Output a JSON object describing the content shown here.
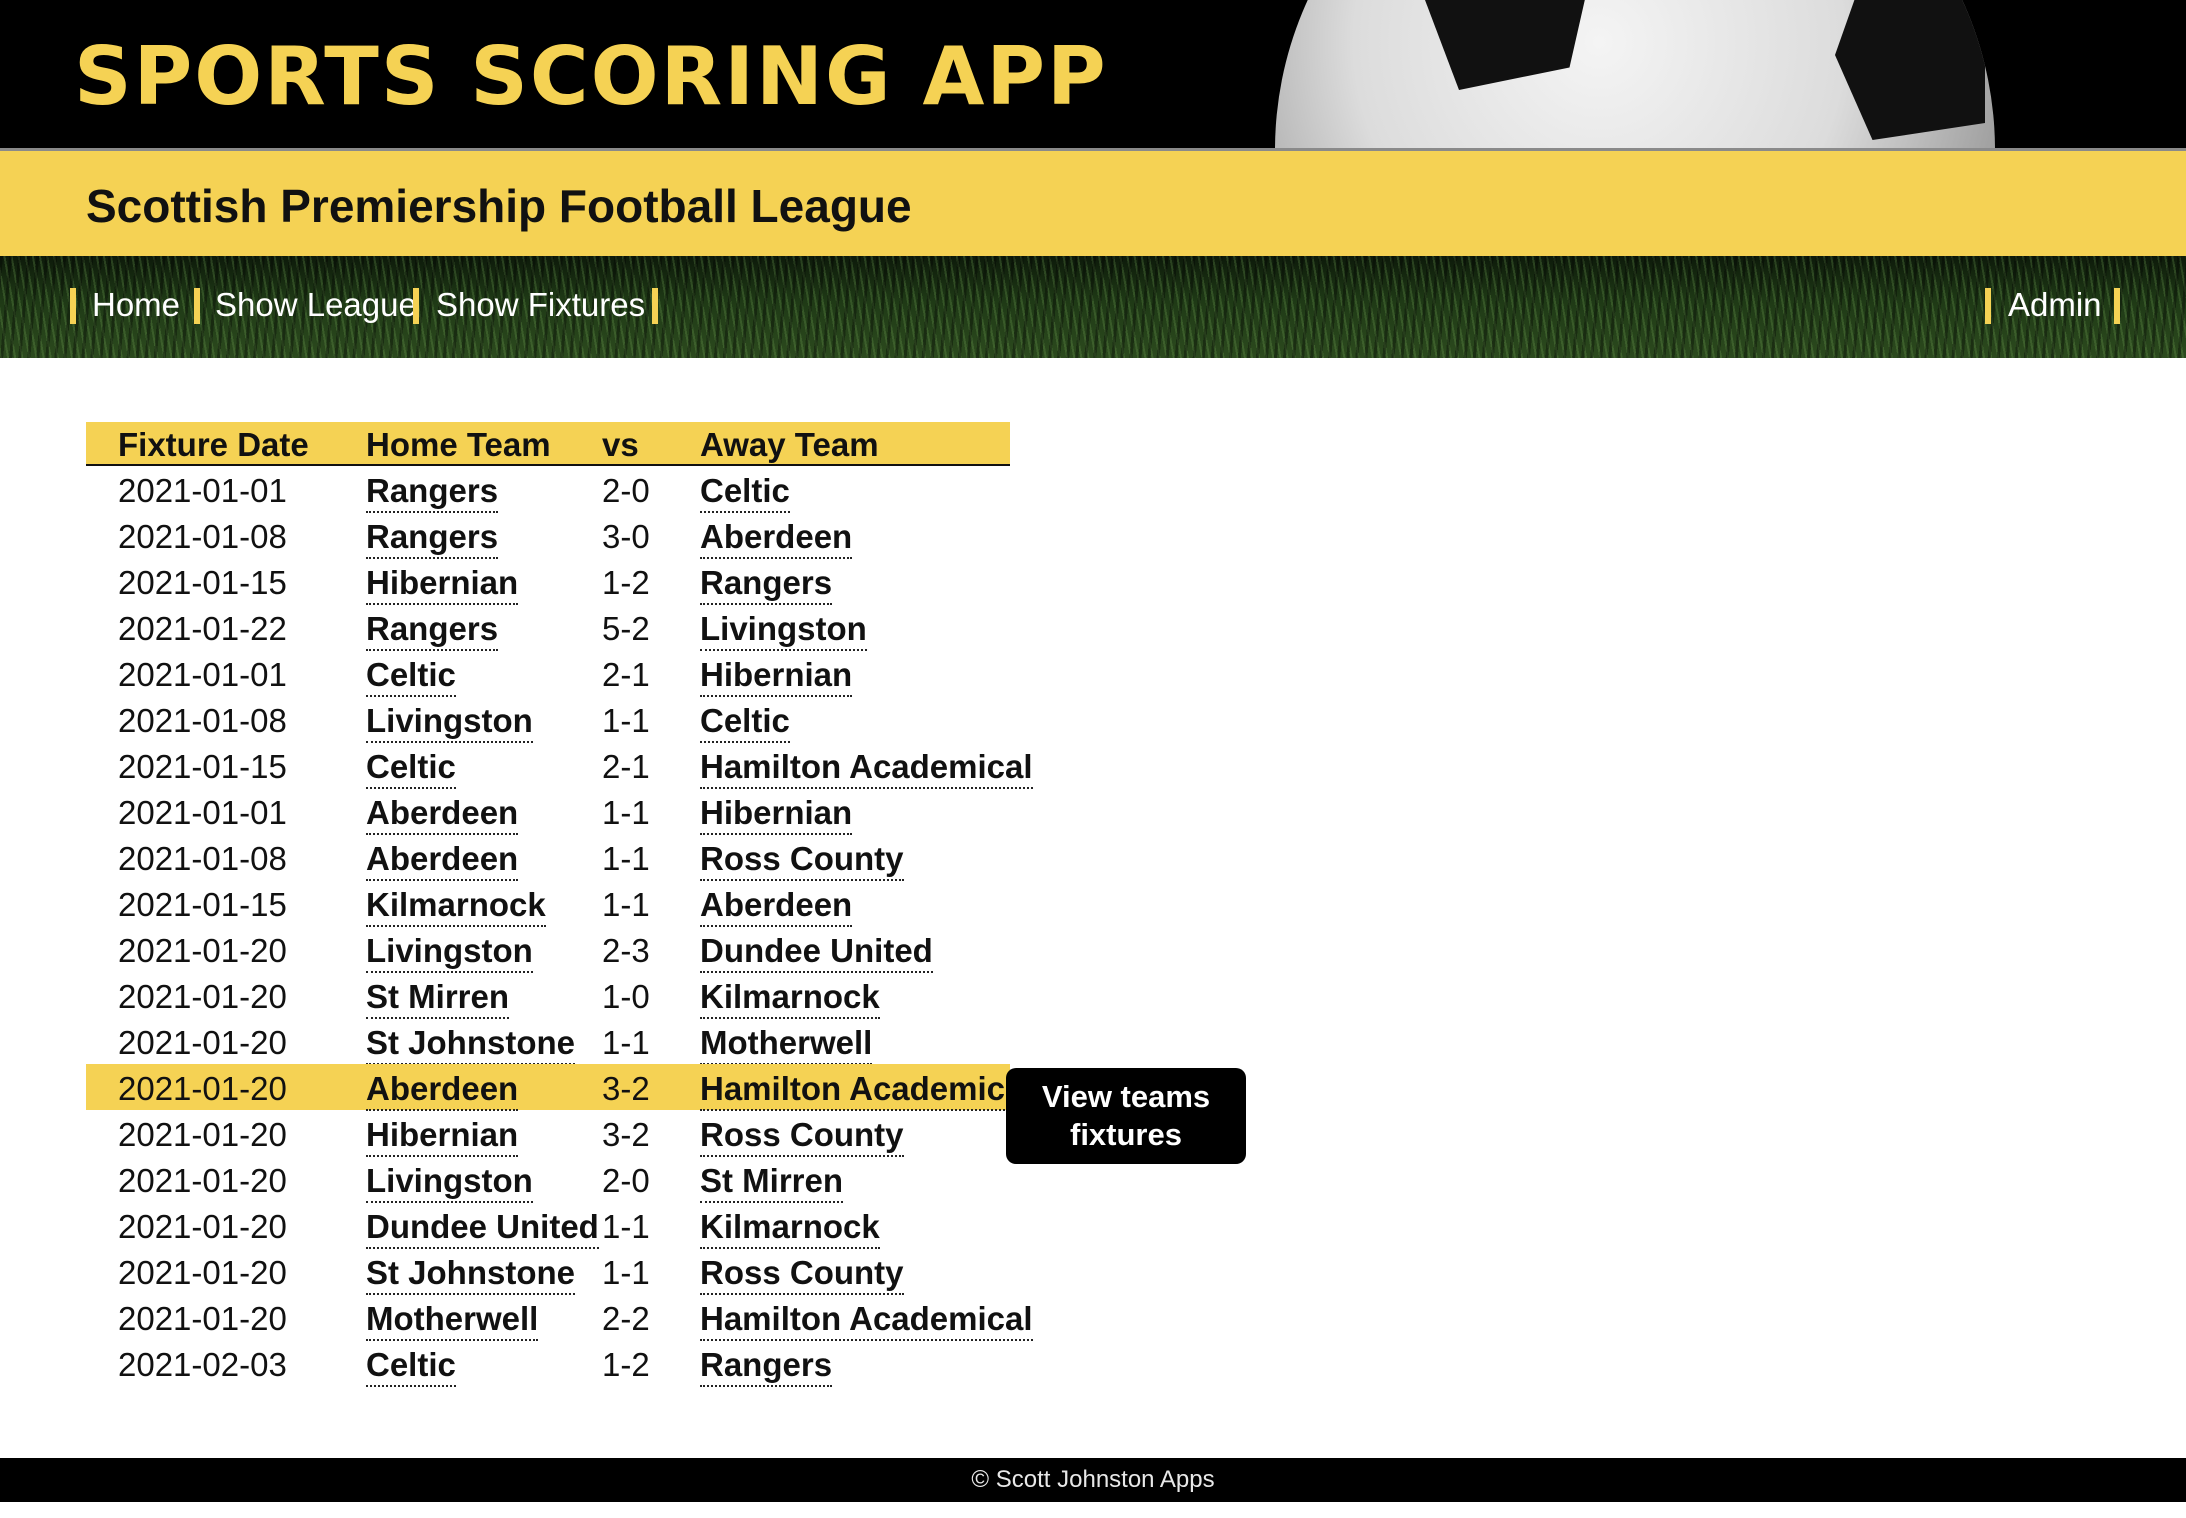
{
  "app": {
    "title": "SPORTS SCORING APP",
    "league_title": "Scottish Premiership Football League"
  },
  "colors": {
    "accent": "#f5d254",
    "header_bg": "#000000",
    "text": "#111111"
  },
  "nav": {
    "items": [
      "Home",
      "Show League",
      "Show Fixtures"
    ],
    "admin": "Admin"
  },
  "table": {
    "headers": [
      "Fixture Date",
      "Home Team",
      "vs",
      "Away Team"
    ],
    "highlighted_row_index": 13,
    "rows": [
      {
        "date": "2021-01-01",
        "home": "Rangers",
        "score": "2-0",
        "away": "Celtic"
      },
      {
        "date": "2021-01-08",
        "home": "Rangers",
        "score": "3-0",
        "away": "Aberdeen"
      },
      {
        "date": "2021-01-15",
        "home": "Hibernian",
        "score": "1-2",
        "away": "Rangers"
      },
      {
        "date": "2021-01-22",
        "home": "Rangers",
        "score": "5-2",
        "away": "Livingston"
      },
      {
        "date": "2021-01-01",
        "home": "Celtic",
        "score": "2-1",
        "away": "Hibernian"
      },
      {
        "date": "2021-01-08",
        "home": "Livingston",
        "score": "1-1",
        "away": "Celtic"
      },
      {
        "date": "2021-01-15",
        "home": "Celtic",
        "score": "2-1",
        "away": "Hamilton Academical"
      },
      {
        "date": "2021-01-01",
        "home": "Aberdeen",
        "score": "1-1",
        "away": "Hibernian"
      },
      {
        "date": "2021-01-08",
        "home": "Aberdeen",
        "score": "1-1",
        "away": "Ross County"
      },
      {
        "date": "2021-01-15",
        "home": "Kilmarnock",
        "score": "1-1",
        "away": "Aberdeen"
      },
      {
        "date": "2021-01-20",
        "home": "Livingston",
        "score": "2-3",
        "away": "Dundee United"
      },
      {
        "date": "2021-01-20",
        "home": "St Mirren",
        "score": "1-0",
        "away": "Kilmarnock"
      },
      {
        "date": "2021-01-20",
        "home": "St Johnstone",
        "score": "1-1",
        "away": "Motherwell"
      },
      {
        "date": "2021-01-20",
        "home": "Aberdeen",
        "score": "3-2",
        "away": "Hamilton Academical"
      },
      {
        "date": "2021-01-20",
        "home": "Hibernian",
        "score": "3-2",
        "away": "Ross County"
      },
      {
        "date": "2021-01-20",
        "home": "Livingston",
        "score": "2-0",
        "away": "St Mirren"
      },
      {
        "date": "2021-01-20",
        "home": "Dundee United",
        "score": "1-1",
        "away": "Kilmarnock"
      },
      {
        "date": "2021-01-20",
        "home": "St Johnstone",
        "score": "1-1",
        "away": "Ross County"
      },
      {
        "date": "2021-01-20",
        "home": "Motherwell",
        "score": "2-2",
        "away": "Hamilton Academical"
      },
      {
        "date": "2021-02-03",
        "home": "Celtic",
        "score": "1-2",
        "away": "Rangers"
      }
    ]
  },
  "tooltip": {
    "text": "View teams fixtures"
  },
  "footer": {
    "text": "© Scott Johnston Apps"
  }
}
